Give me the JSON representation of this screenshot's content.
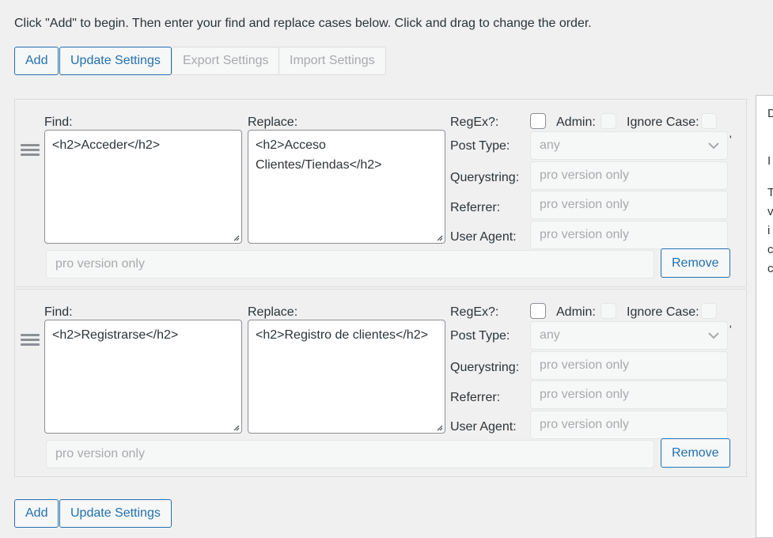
{
  "intro_text": "Click \"Add\" to begin. Then enter your find and replace cases below. Click and drag to change the order.",
  "toolbar": {
    "add_label": "Add",
    "update_label": "Update Settings",
    "export_label": "Export Settings",
    "import_label": "Import Settings"
  },
  "labels": {
    "find": "Find:",
    "replace": "Replace:",
    "regex": "RegEx?:",
    "admin": "Admin:",
    "ignore_case": "Ignore Case:",
    "post_type": "Post Type:",
    "querystring": "Querystring:",
    "referrer": "Referrer:",
    "user_agent": "User Agent:",
    "remove": "Remove"
  },
  "cases": [
    {
      "find": "<h2>Acceder</h2>",
      "replace": "<h2>Acceso Clientes/Tiendas</h2>",
      "post_type": "any",
      "querystring": "pro version only",
      "referrer": "pro version only",
      "user_agent": "pro version only",
      "extra": "pro version only",
      "regex_checked": false,
      "admin_checked": false,
      "ignore_case_checked": false
    },
    {
      "find": "<h2>Registrarse</h2>",
      "replace": "<h2>Registro de clientes</h2>",
      "post_type": "any",
      "querystring": "pro version only",
      "referrer": "pro version only",
      "user_agent": "pro version only",
      "extra": "pro version only",
      "regex_checked": false,
      "admin_checked": false,
      "ignore_case_checked": false
    }
  ],
  "bottom_toolbar": {
    "add_label": "Add",
    "update_label": "Update Settings"
  },
  "sidebar": {
    "letters": [
      "D",
      "I",
      "T",
      "v",
      "i",
      "c",
      "c"
    ]
  },
  "colors": {
    "accent": "#2271b1",
    "background": "#f0f0f1",
    "disabled_text": "#a7aaad"
  }
}
